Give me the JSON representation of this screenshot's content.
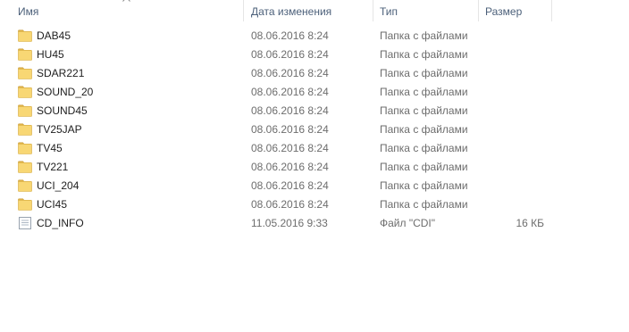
{
  "columns": {
    "name": "Имя",
    "date": "Дата изменения",
    "type": "Тип",
    "size": "Размер"
  },
  "sort_icon": "chevron-up-icon",
  "files": [
    {
      "name": "DAB45",
      "date": "08.06.2016 8:24",
      "type": "Папка с файлами",
      "size": "",
      "icon": "folder-icon"
    },
    {
      "name": "HU45",
      "date": "08.06.2016 8:24",
      "type": "Папка с файлами",
      "size": "",
      "icon": "folder-icon"
    },
    {
      "name": "SDAR221",
      "date": "08.06.2016 8:24",
      "type": "Папка с файлами",
      "size": "",
      "icon": "folder-icon"
    },
    {
      "name": "SOUND_20",
      "date": "08.06.2016 8:24",
      "type": "Папка с файлами",
      "size": "",
      "icon": "folder-icon"
    },
    {
      "name": "SOUND45",
      "date": "08.06.2016 8:24",
      "type": "Папка с файлами",
      "size": "",
      "icon": "folder-icon"
    },
    {
      "name": "TV25JAP",
      "date": "08.06.2016 8:24",
      "type": "Папка с файлами",
      "size": "",
      "icon": "folder-icon"
    },
    {
      "name": "TV45",
      "date": "08.06.2016 8:24",
      "type": "Папка с файлами",
      "size": "",
      "icon": "folder-icon"
    },
    {
      "name": "TV221",
      "date": "08.06.2016 8:24",
      "type": "Папка с файлами",
      "size": "",
      "icon": "folder-icon"
    },
    {
      "name": "UCI_204",
      "date": "08.06.2016 8:24",
      "type": "Папка с файлами",
      "size": "",
      "icon": "folder-icon"
    },
    {
      "name": "UCI45",
      "date": "08.06.2016 8:24",
      "type": "Папка с файлами",
      "size": "",
      "icon": "folder-icon"
    },
    {
      "name": "CD_INFO",
      "date": "11.05.2016 9:33",
      "type": "Файл \"CDI\"",
      "size": "16 КБ",
      "icon": "file-icon"
    }
  ]
}
